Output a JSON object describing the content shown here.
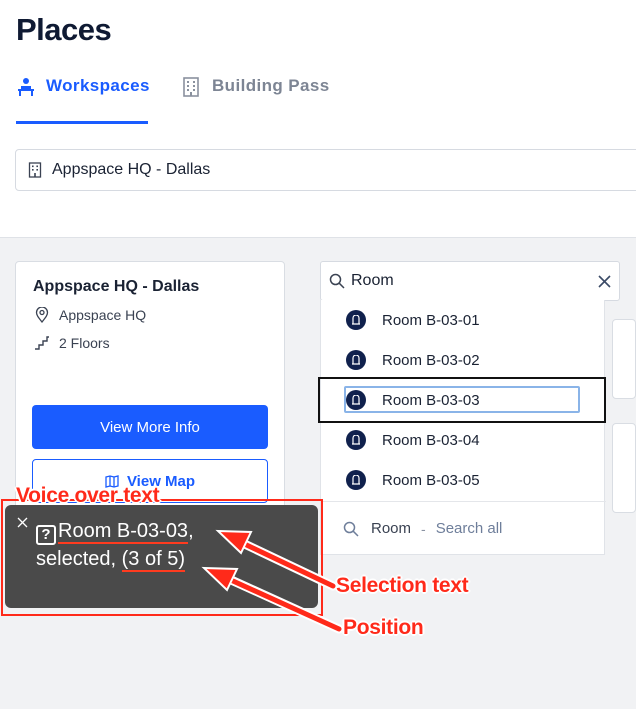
{
  "page": {
    "title": "Places"
  },
  "tabs": [
    {
      "label": "Workspaces",
      "icon": "person-desk-icon",
      "active": true
    },
    {
      "label": "Building Pass",
      "icon": "building-icon",
      "active": false
    }
  ],
  "location_select": {
    "value": "Appspace HQ - Dallas",
    "icon": "building-icon"
  },
  "card": {
    "name": "Appspace HQ - Dallas",
    "address": "Appspace HQ",
    "floors": "2 Floors",
    "primary_button": "View More Info",
    "secondary_button": "View Map"
  },
  "search": {
    "value": "Room",
    "icon": "search-icon",
    "clear_icon": "close-icon"
  },
  "results": [
    {
      "label": "Room B-03-01"
    },
    {
      "label": "Room B-03-02"
    },
    {
      "label": "Room B-03-03",
      "selected": true
    },
    {
      "label": "Room B-03-04"
    },
    {
      "label": "Room B-03-05"
    }
  ],
  "search_all": {
    "query": "Room",
    "separator": "-",
    "hint": "Search all"
  },
  "voiceover": {
    "glyph": "?",
    "room": "Room B-03-03",
    "comma": ",",
    "selected": "selected,",
    "position": "(3 of 5)"
  },
  "annotations": {
    "voiceover_label": "Voice over text",
    "selection_label": "Selection text",
    "position_label": "Position"
  },
  "colors": {
    "accent": "#1a5cff",
    "annotation_red": "#ff2a1a",
    "room_badge": "#10214d",
    "voiceover_bg": "#4a4a4a"
  }
}
